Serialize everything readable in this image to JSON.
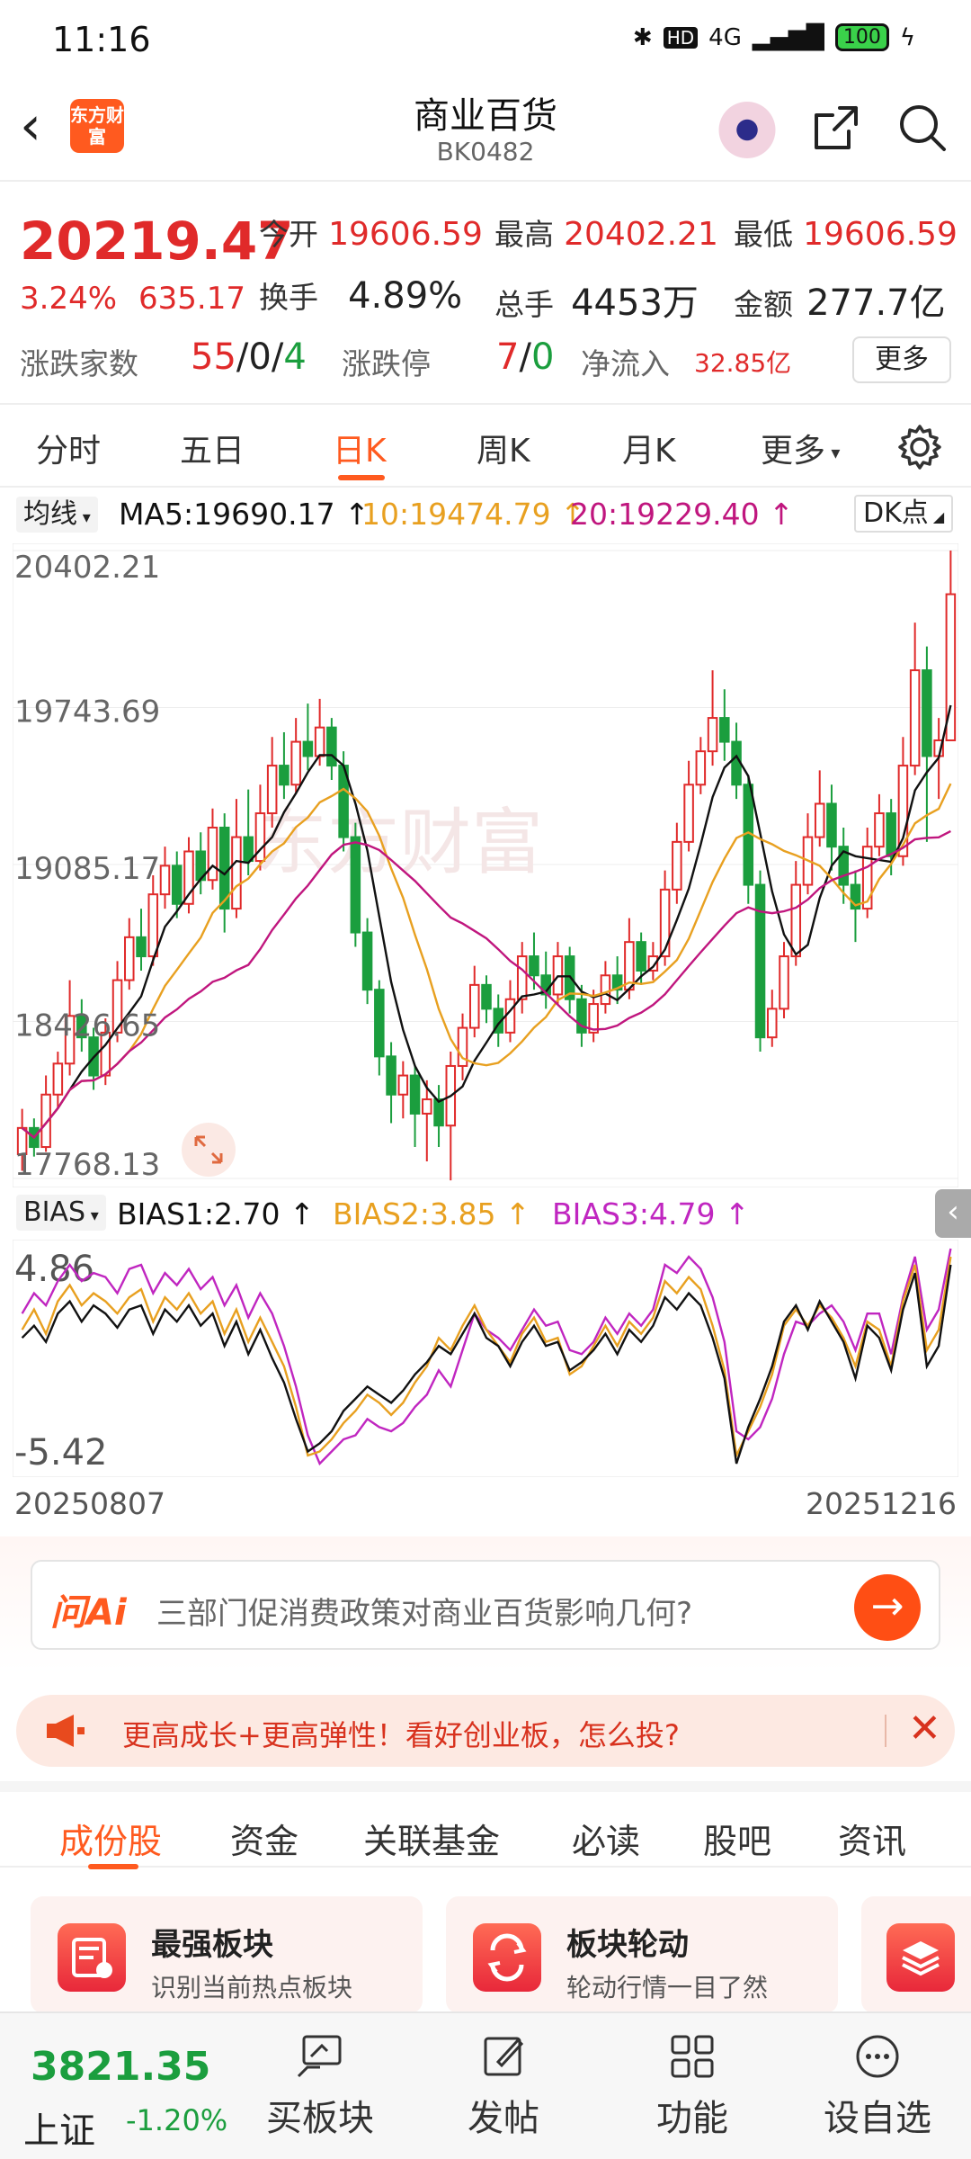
{
  "status_bar": {
    "time": "11:16",
    "network": "4G",
    "battery": "100"
  },
  "header": {
    "title": "商业百货",
    "code": "BK0482",
    "logo_text": "东方财富"
  },
  "quote": {
    "price": "20219.47",
    "change_pct": "3.24%",
    "change": "635.17",
    "stats": [
      {
        "label": "今开",
        "value": "19606.59",
        "color": "red"
      },
      {
        "label": "最高",
        "value": "20402.21",
        "color": "red"
      },
      {
        "label": "最低",
        "value": "19606.59",
        "color": "red"
      },
      {
        "label": "换手",
        "value": "4.89%",
        "color": "black"
      },
      {
        "label": "总手",
        "value": "4453万",
        "color": "black"
      },
      {
        "label": "金额",
        "value": "277.7亿",
        "color": "black"
      }
    ],
    "updown_label": "涨跌家数",
    "updown": {
      "up": "55",
      "flat": "0",
      "down": "4"
    },
    "limit_label": "涨跌停",
    "limit": {
      "up": "7",
      "down": "0"
    },
    "inflow_label": "净流入",
    "inflow": "32.85亿",
    "more_label": "更多"
  },
  "chart_tabs": [
    "分时",
    "五日",
    "日K",
    "周K",
    "月K",
    "更多"
  ],
  "active_chart_tab": 2,
  "ma": {
    "selector": "均线",
    "ma5": "MA5:19690.17",
    "ma10": "10:19474.79",
    "ma20": "20:19229.40",
    "dk_button": "DK点"
  },
  "bias": {
    "selector": "BIAS",
    "bias1": "BIAS1:2.70",
    "bias2": "BIAS2:3.85",
    "bias3": "BIAS3:4.79",
    "top_label": "4.86",
    "bottom_label": "-5.42"
  },
  "colors": {
    "up": "#e02a2a",
    "down": "#1b9e3e",
    "ma5": "#111111",
    "ma10": "#e8a020",
    "ma20": "#c0167e",
    "bias3": "#c026c0",
    "accent": "#ff5a1f"
  },
  "chart_data": {
    "type": "candlestick",
    "y_labels": [
      "20402.21",
      "19743.69",
      "19085.17",
      "18426.65",
      "17768.13"
    ],
    "ylim": [
      17768.13,
      20402.21
    ],
    "x_start": "20250807",
    "x_end": "20251216",
    "series": [
      {
        "o": 17870,
        "c": 17980,
        "h": 18060,
        "l": 17800
      },
      {
        "o": 17980,
        "c": 17900,
        "h": 18020,
        "l": 17860
      },
      {
        "o": 17900,
        "c": 18120,
        "h": 18200,
        "l": 17880
      },
      {
        "o": 18120,
        "c": 18250,
        "h": 18300,
        "l": 18060
      },
      {
        "o": 18250,
        "c": 18450,
        "h": 18600,
        "l": 18200
      },
      {
        "o": 18450,
        "c": 18360,
        "h": 18520,
        "l": 18300
      },
      {
        "o": 18360,
        "c": 18200,
        "h": 18400,
        "l": 18140
      },
      {
        "o": 18200,
        "c": 18380,
        "h": 18440,
        "l": 18160
      },
      {
        "o": 18380,
        "c": 18600,
        "h": 18680,
        "l": 18340
      },
      {
        "o": 18600,
        "c": 18780,
        "h": 18860,
        "l": 18560
      },
      {
        "o": 18780,
        "c": 18700,
        "h": 18900,
        "l": 18640
      },
      {
        "o": 18700,
        "c": 18960,
        "h": 19040,
        "l": 18660
      },
      {
        "o": 18960,
        "c": 19080,
        "h": 19160,
        "l": 18900
      },
      {
        "o": 19080,
        "c": 18920,
        "h": 19140,
        "l": 18860
      },
      {
        "o": 18920,
        "c": 19140,
        "h": 19200,
        "l": 18880
      },
      {
        "o": 19140,
        "c": 19020,
        "h": 19220,
        "l": 18960
      },
      {
        "o": 19020,
        "c": 19240,
        "h": 19320,
        "l": 18980
      },
      {
        "o": 19240,
        "c": 18900,
        "h": 19300,
        "l": 18800
      },
      {
        "o": 18900,
        "c": 19200,
        "h": 19360,
        "l": 18860
      },
      {
        "o": 19200,
        "c": 19100,
        "h": 19400,
        "l": 19040
      },
      {
        "o": 19100,
        "c": 19300,
        "h": 19420,
        "l": 19060
      },
      {
        "o": 19300,
        "c": 19500,
        "h": 19620,
        "l": 19240
      },
      {
        "o": 19500,
        "c": 19420,
        "h": 19640,
        "l": 19360
      },
      {
        "o": 19420,
        "c": 19600,
        "h": 19700,
        "l": 19380
      },
      {
        "o": 19600,
        "c": 19540,
        "h": 19760,
        "l": 19480
      },
      {
        "o": 19540,
        "c": 19660,
        "h": 19780,
        "l": 19500
      },
      {
        "o": 19660,
        "c": 19500,
        "h": 19700,
        "l": 19440
      },
      {
        "o": 19500,
        "c": 19200,
        "h": 19560,
        "l": 19140
      },
      {
        "o": 19200,
        "c": 18800,
        "h": 19260,
        "l": 18740
      },
      {
        "o": 18800,
        "c": 18560,
        "h": 18860,
        "l": 18500
      },
      {
        "o": 18560,
        "c": 18280,
        "h": 18600,
        "l": 18200
      },
      {
        "o": 18280,
        "c": 18120,
        "h": 18340,
        "l": 18000
      },
      {
        "o": 18120,
        "c": 18200,
        "h": 18260,
        "l": 18020
      },
      {
        "o": 18200,
        "c": 18040,
        "h": 18240,
        "l": 17900
      },
      {
        "o": 18040,
        "c": 18100,
        "h": 18180,
        "l": 17840
      },
      {
        "o": 18100,
        "c": 17990,
        "h": 18160,
        "l": 17900
      },
      {
        "o": 17990,
        "c": 18240,
        "h": 18300,
        "l": 17760
      },
      {
        "o": 18240,
        "c": 18400,
        "h": 18460,
        "l": 18180
      },
      {
        "o": 18400,
        "c": 18580,
        "h": 18660,
        "l": 18360
      },
      {
        "o": 18580,
        "c": 18480,
        "h": 18620,
        "l": 18420
      },
      {
        "o": 18480,
        "c": 18380,
        "h": 18540,
        "l": 18320
      },
      {
        "o": 18380,
        "c": 18520,
        "h": 18600,
        "l": 18340
      },
      {
        "o": 18520,
        "c": 18700,
        "h": 18760,
        "l": 18460
      },
      {
        "o": 18700,
        "c": 18620,
        "h": 18800,
        "l": 18560
      },
      {
        "o": 18620,
        "c": 18540,
        "h": 18720,
        "l": 18480
      },
      {
        "o": 18540,
        "c": 18700,
        "h": 18760,
        "l": 18500
      },
      {
        "o": 18700,
        "c": 18520,
        "h": 18740,
        "l": 18460
      },
      {
        "o": 18520,
        "c": 18380,
        "h": 18580,
        "l": 18320
      },
      {
        "o": 18380,
        "c": 18500,
        "h": 18560,
        "l": 18340
      },
      {
        "o": 18500,
        "c": 18620,
        "h": 18680,
        "l": 18460
      },
      {
        "o": 18620,
        "c": 18560,
        "h": 18700,
        "l": 18500
      },
      {
        "o": 18560,
        "c": 18760,
        "h": 18860,
        "l": 18520
      },
      {
        "o": 18760,
        "c": 18640,
        "h": 18800,
        "l": 18580
      },
      {
        "o": 18640,
        "c": 18700,
        "h": 18760,
        "l": 18600
      },
      {
        "o": 18700,
        "c": 18980,
        "h": 19060,
        "l": 18660
      },
      {
        "o": 18980,
        "c": 19180,
        "h": 19260,
        "l": 18920
      },
      {
        "o": 19180,
        "c": 19420,
        "h": 19520,
        "l": 19140
      },
      {
        "o": 19420,
        "c": 19560,
        "h": 19620,
        "l": 19380
      },
      {
        "o": 19560,
        "c": 19700,
        "h": 19900,
        "l": 19500
      },
      {
        "o": 19700,
        "c": 19600,
        "h": 19820,
        "l": 19520
      },
      {
        "o": 19600,
        "c": 19420,
        "h": 19680,
        "l": 19360
      },
      {
        "o": 19420,
        "c": 19000,
        "h": 19460,
        "l": 18920
      },
      {
        "o": 19000,
        "c": 18360,
        "h": 19060,
        "l": 18300
      },
      {
        "o": 18360,
        "c": 18480,
        "h": 18560,
        "l": 18320
      },
      {
        "o": 18480,
        "c": 18700,
        "h": 18760,
        "l": 18440
      },
      {
        "o": 18700,
        "c": 19000,
        "h": 19100,
        "l": 18660
      },
      {
        "o": 19000,
        "c": 19200,
        "h": 19300,
        "l": 18960
      },
      {
        "o": 19200,
        "c": 19340,
        "h": 19480,
        "l": 19160
      },
      {
        "o": 19340,
        "c": 19160,
        "h": 19420,
        "l": 19060
      },
      {
        "o": 19160,
        "c": 19000,
        "h": 19240,
        "l": 18920
      },
      {
        "o": 19000,
        "c": 18900,
        "h": 19060,
        "l": 18760
      },
      {
        "o": 18900,
        "c": 19160,
        "h": 19240,
        "l": 18860
      },
      {
        "o": 19160,
        "c": 19300,
        "h": 19380,
        "l": 19120
      },
      {
        "o": 19300,
        "c": 19120,
        "h": 19360,
        "l": 19040
      },
      {
        "o": 19120,
        "c": 19500,
        "h": 19620,
        "l": 19080
      },
      {
        "o": 19500,
        "c": 19900,
        "h": 20100,
        "l": 19460
      },
      {
        "o": 19900,
        "c": 19540,
        "h": 20000,
        "l": 19180
      },
      {
        "o": 19540,
        "c": 19606,
        "h": 19700,
        "l": 19360
      },
      {
        "o": 19606,
        "c": 20219,
        "h": 20402,
        "l": 19606
      }
    ]
  },
  "bias_data": {
    "ylim": [
      -5.42,
      5.4
    ],
    "bias1": [
      1.0,
      1.6,
      0.8,
      2.2,
      2.8,
      1.8,
      2.6,
      2.2,
      1.5,
      2.4,
      2.6,
      1.2,
      2.4,
      1.8,
      2.6,
      1.6,
      2.2,
      0.6,
      1.8,
      0.2,
      1.4,
      0.0,
      -1.2,
      -3.0,
      -4.6,
      -4.2,
      -3.6,
      -2.6,
      -2.0,
      -1.4,
      -1.8,
      -2.2,
      -1.6,
      -0.8,
      -0.2,
      0.6,
      0.2,
      1.2,
      2.2,
      1.0,
      0.6,
      -0.4,
      0.8,
      1.6,
      0.6,
      0.8,
      -0.6,
      -0.2,
      0.4,
      1.2,
      0.2,
      1.4,
      0.8,
      1.6,
      3.0,
      2.4,
      3.2,
      2.6,
      1.0,
      -1.0,
      -5.2,
      -3.4,
      -2.0,
      -0.4,
      1.8,
      2.6,
      1.4,
      2.8,
      1.8,
      0.8,
      -1.0,
      1.6,
      1.0,
      -0.6,
      2.4,
      4.2,
      -0.4,
      0.6,
      4.6
    ],
    "bias2": [
      1.4,
      2.4,
      1.2,
      2.8,
      3.6,
      2.6,
      3.2,
      2.8,
      2.2,
      3.0,
      3.4,
      1.8,
      3.0,
      2.4,
      3.2,
      2.2,
      2.8,
      1.2,
      2.4,
      0.8,
      2.0,
      0.8,
      -0.4,
      -2.4,
      -4.8,
      -4.6,
      -4.0,
      -3.2,
      -2.6,
      -1.8,
      -2.2,
      -2.8,
      -2.2,
      -1.2,
      -0.4,
      1.0,
      0.4,
      1.6,
      2.6,
      1.4,
      0.6,
      -0.2,
      1.2,
      2.0,
      0.8,
      1.0,
      -0.8,
      -0.4,
      0.6,
      1.6,
      0.6,
      1.8,
      1.2,
      2.0,
      3.8,
      3.2,
      4.0,
      3.4,
      1.6,
      -0.6,
      -4.8,
      -3.6,
      -2.4,
      -0.8,
      1.6,
      2.4,
      1.6,
      2.6,
      2.0,
      1.0,
      -0.4,
      1.8,
      1.4,
      -0.4,
      2.8,
      4.6,
      0.4,
      1.4,
      5.0
    ],
    "bias3": [
      2.2,
      3.2,
      2.6,
      3.8,
      4.6,
      3.8,
      4.2,
      4.0,
      3.2,
      4.4,
      4.6,
      3.2,
      4.2,
      3.6,
      4.4,
      3.4,
      4.0,
      2.6,
      3.6,
      2.0,
      3.2,
      2.2,
      0.6,
      -1.4,
      -3.8,
      -5.2,
      -4.6,
      -4.0,
      -3.8,
      -3.0,
      -3.4,
      -3.6,
      -3.2,
      -2.4,
      -1.8,
      -0.6,
      -1.4,
      0.4,
      2.2,
      1.4,
      1.0,
      0.4,
      1.4,
      2.4,
      1.6,
      1.8,
      0.4,
      0.2,
      0.8,
      2.0,
      1.2,
      2.2,
      1.6,
      2.4,
      4.6,
      4.2,
      5.0,
      4.4,
      3.0,
      0.8,
      -3.6,
      -4.0,
      -3.4,
      -2.0,
      0.2,
      1.8,
      1.6,
      2.2,
      2.6,
      1.8,
      0.4,
      2.2,
      2.2,
      0.2,
      3.0,
      5.0,
      1.4,
      2.4,
      5.4
    ]
  },
  "ai": {
    "logo": "问Ai",
    "question": "三部门促消费政策对商业百货影响几何?"
  },
  "promo": {
    "text": "更高成长+更高弹性！看好创业板，怎么投?"
  },
  "section_tabs": [
    "成份股",
    "资金",
    "关联基金",
    "必读",
    "股吧",
    "资讯"
  ],
  "cards": [
    {
      "title": "最强板块",
      "subtitle": "识别当前热点板块"
    },
    {
      "title": "板块轮动",
      "subtitle": "轮动行情一目了然"
    }
  ],
  "bottom_bar": {
    "index_value": "3821.35",
    "index_name": "上证",
    "index_pct": "-1.20%",
    "items": [
      "买板块",
      "发帖",
      "功能",
      "设自选"
    ]
  }
}
